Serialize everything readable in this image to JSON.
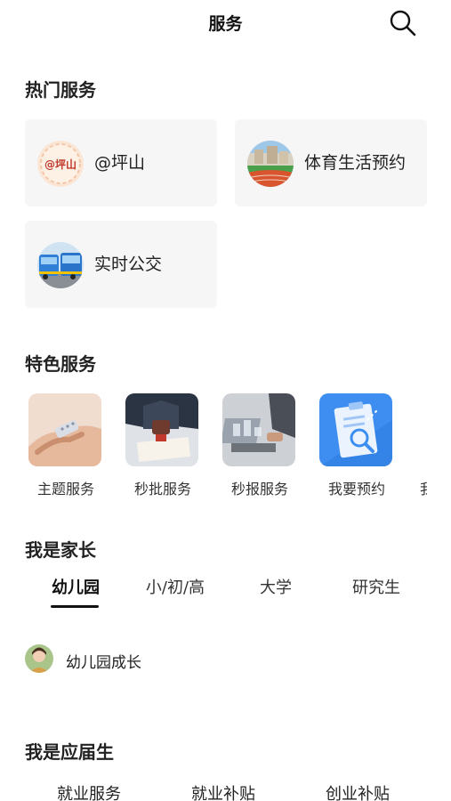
{
  "header": {
    "title": "服务",
    "search_icon": "search-icon"
  },
  "hot": {
    "title": "热门服务",
    "items": [
      {
        "label": "@坪山",
        "badge": "@坪山",
        "icon": "pingshan-logo"
      },
      {
        "label": "体育生活预约",
        "icon": "stadium-photo"
      },
      {
        "label": "实时公交",
        "icon": "bus-photo"
      }
    ]
  },
  "featured": {
    "title": "特色服务",
    "items": [
      {
        "label": "主题服务",
        "icon": "handshake-photo"
      },
      {
        "label": "秒批服务",
        "icon": "stamp-photo"
      },
      {
        "label": "秒报服务",
        "icon": "laptop-photo"
      },
      {
        "label": "我要预约",
        "icon": "clipboard-icon"
      },
      {
        "label": "我",
        "icon": "partial-icon"
      }
    ]
  },
  "parent": {
    "title": "我是家长",
    "tabs": [
      "幼儿园",
      "小/初/高",
      "大学",
      "研究生"
    ],
    "active_tab": "幼儿园",
    "items": [
      {
        "label": "幼儿园成长",
        "icon": "child-avatar"
      }
    ]
  },
  "graduate": {
    "title": "我是应届生",
    "items": [
      "就业服务",
      "就业补贴",
      "创业补贴"
    ]
  },
  "colors": {
    "card_bg": "#f6f6f6",
    "text": "#222222",
    "accent_blue": "#3d8ef0"
  }
}
